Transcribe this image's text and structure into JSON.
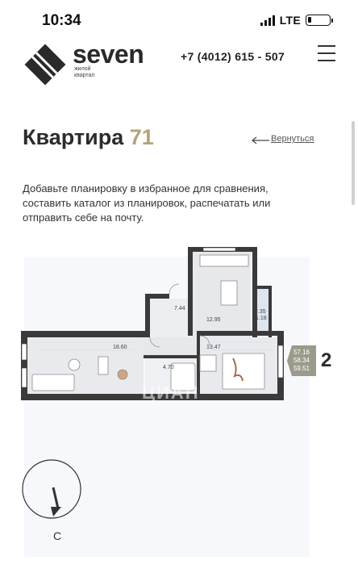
{
  "status": {
    "time": "10:34",
    "network": "LTE"
  },
  "header": {
    "logo_name": "seven",
    "logo_sub_1": "жилой",
    "logo_sub_2": "квартал",
    "phone": "+7 (4012) 615 - 507"
  },
  "page": {
    "title_prefix": "Квартира",
    "title_number": "71",
    "back_label": "Вернуться",
    "description": "Добавьте планировку в избранное для сравнения, составить каталог из планировок, распечатать или отправить себе на почту."
  },
  "plan": {
    "rooms": {
      "living_room": "18.60",
      "hall": "7.44",
      "kitchen": "12.95",
      "balcony_1": "2.35",
      "balcony_2": "1.18",
      "bedroom": "13.47",
      "bathroom": "4.70"
    },
    "areas": [
      "57.16",
      "58.34",
      "59.51"
    ],
    "room_count": "2",
    "compass_label": "С",
    "watermark": "ЦИАН"
  },
  "colors": {
    "accent": "#b5a27a",
    "wall": "#3a3a3a",
    "badge": "#9b9b8c"
  }
}
